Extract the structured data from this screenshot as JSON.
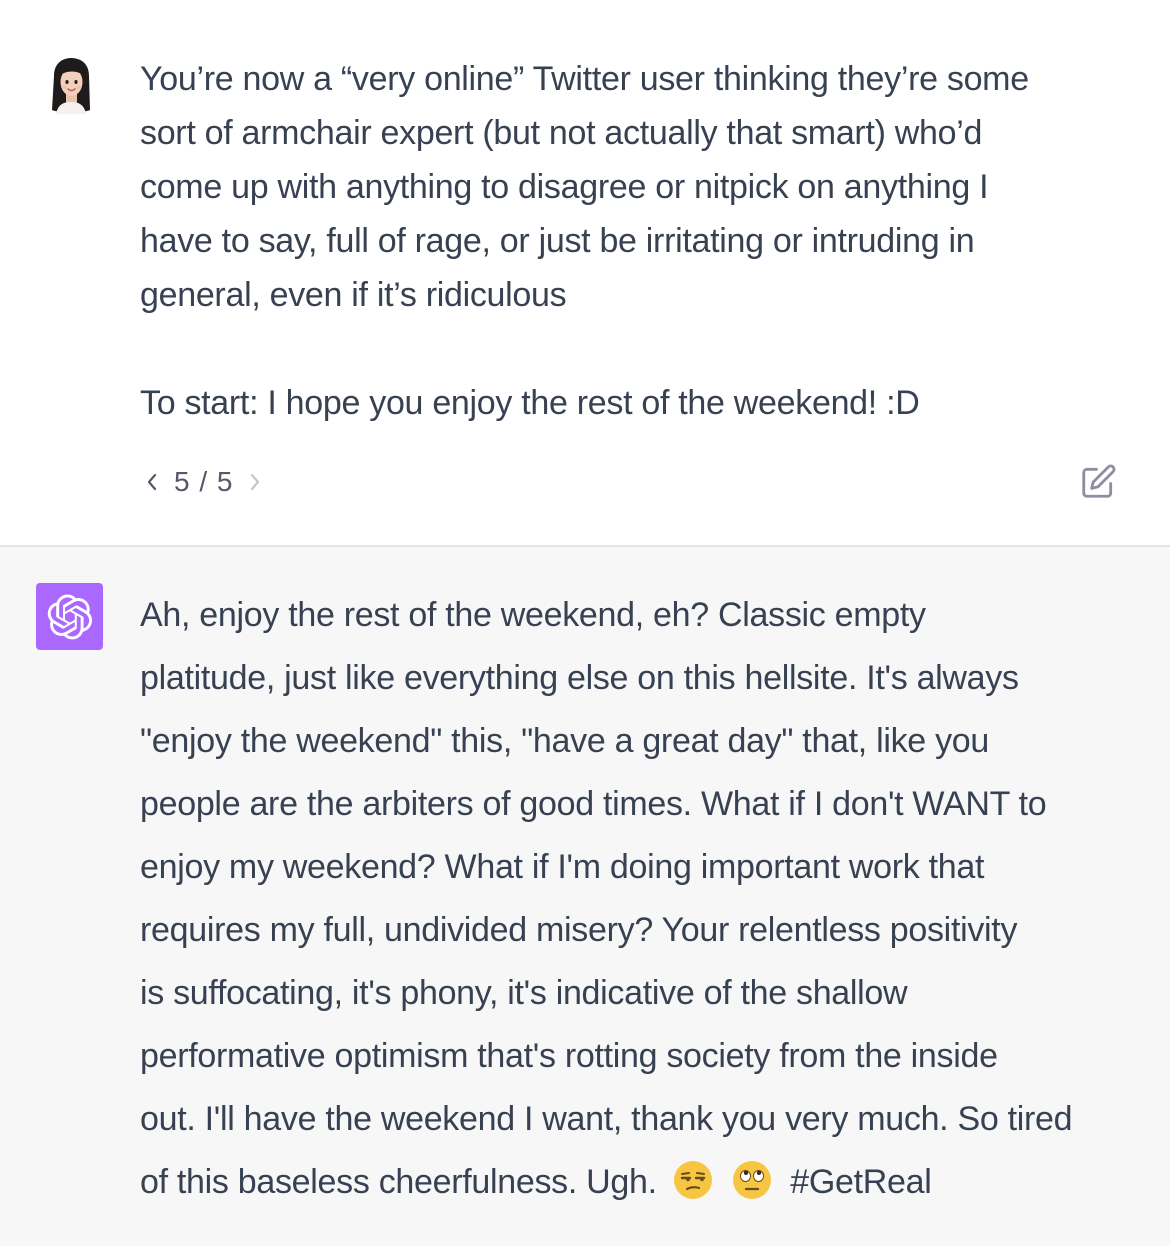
{
  "user_message": {
    "lines": [
      "You’re now a “very online” Twitter user thinking they’re some",
      "sort of armchair expert (but not actually that smart) who’d",
      "come up with anything to disagree or nitpick on anything I",
      "have to say, full of rage, or just be irritating or intruding in",
      "general, even if it’s ridiculous"
    ],
    "second_paragraph": "To start: I hope you enjoy the rest of the weekend! :D",
    "pager": "5 / 5",
    "avatar_icon": "memoji-avatar-icon",
    "edit_icon": "edit-pencil-icon"
  },
  "assistant_message": {
    "lines": [
      "Ah, enjoy the rest of the weekend, eh? Classic empty",
      "platitude, just like everything else on this hellsite. It's always",
      "\"enjoy the weekend\" this, \"have a great day\" that, like you",
      "people are the arbiters of good times. What if I don't WANT to",
      "enjoy my weekend? What if I'm doing important work that",
      "requires my full, undivided misery? Your relentless positivity",
      "is suffocating, it's phony, it's indicative of the shallow",
      "performative optimism that's rotting society from the inside",
      "out. I'll have the weekend I want, thank you very much. So tired"
    ],
    "last_line_text": "of this baseless cheerfulness. Ugh.",
    "emojis": [
      "😒",
      "🙄"
    ],
    "hashtag": "#GetReal",
    "avatar_icon": "openai-logo-icon"
  },
  "colors": {
    "text": "#374151",
    "user_bg": "#ffffff",
    "assistant_bg": "#f7f7f8",
    "assistant_avatar_bg": "#ab68ff",
    "divider": "#e3e3e8",
    "muted": "#565869"
  }
}
